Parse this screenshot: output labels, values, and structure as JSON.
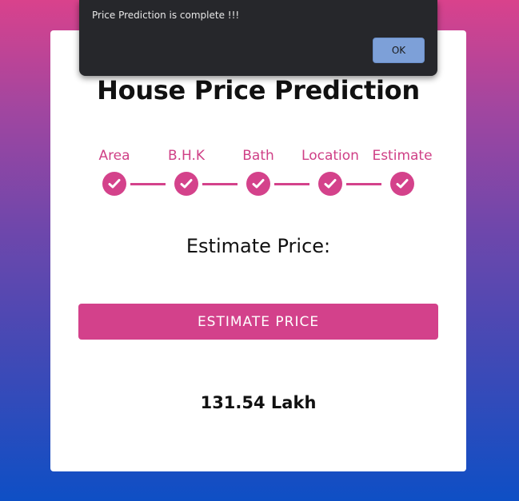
{
  "page": {
    "title": "House Price Prediction",
    "steps": [
      {
        "label": "Area"
      },
      {
        "label": "B.H.K"
      },
      {
        "label": "Bath"
      },
      {
        "label": "Location"
      },
      {
        "label": "Estimate"
      }
    ],
    "estimate_label": "Estimate Price:",
    "estimate_button": "ESTIMATE PRICE",
    "result": "131.54 Lakh",
    "accent_color": "#d4428b"
  },
  "dialog": {
    "message": "Price Prediction is complete !!!",
    "ok_label": "OK"
  }
}
